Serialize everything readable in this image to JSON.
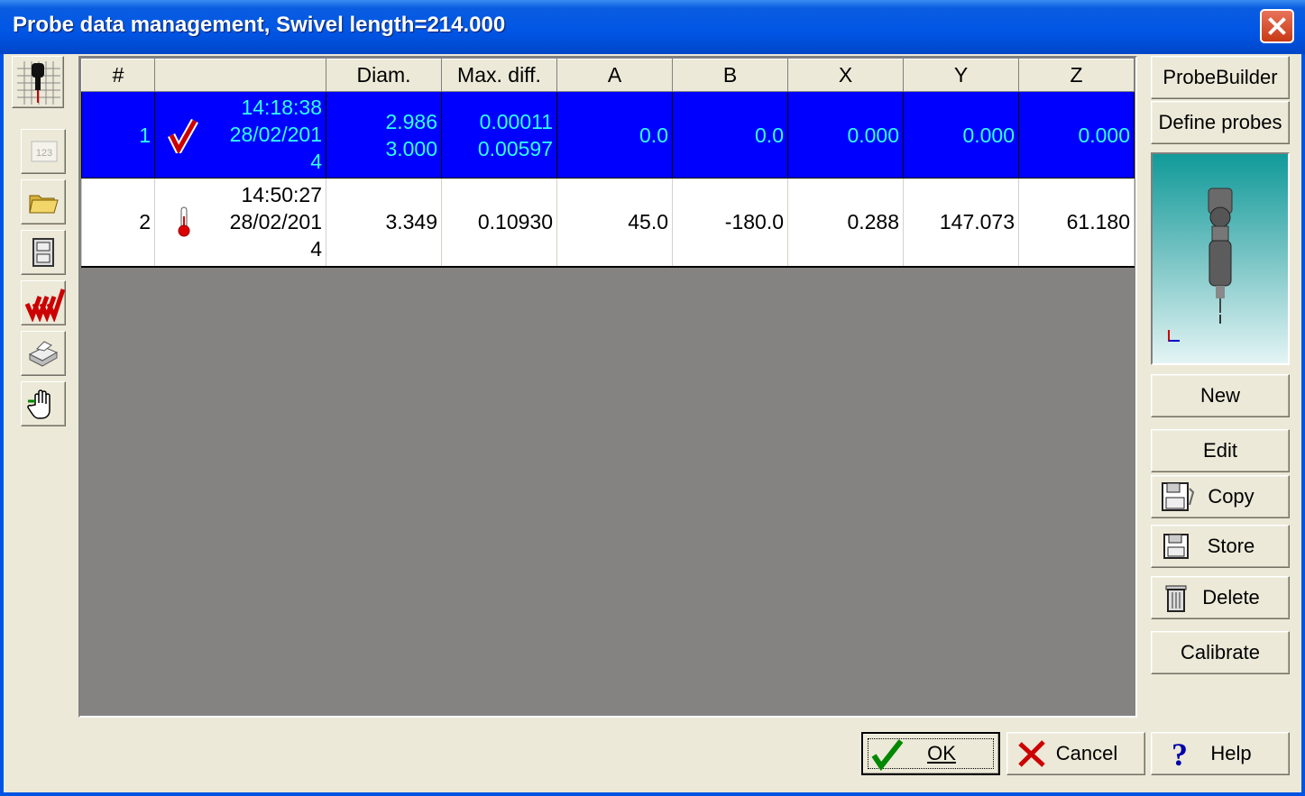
{
  "window": {
    "title": "Probe data management, Swivel length=214.000"
  },
  "table": {
    "columns": [
      "#",
      "",
      "Diam.",
      "Max. diff.",
      "A",
      "B",
      "X",
      "Y",
      "Z"
    ],
    "rows": [
      {
        "num": "1",
        "status_icon": "checkmark-icon",
        "time": "14:18:38",
        "date": "28/02/2014",
        "diam_1": "2.986",
        "diam_2": "3.000",
        "maxdiff_1": "0.00011",
        "maxdiff_2": "0.00597",
        "a": "0.0",
        "b": "0.0",
        "x": "0.000",
        "y": "0.000",
        "z": "0.000",
        "selected": true
      },
      {
        "num": "2",
        "status_icon": "thermometer-icon",
        "time": "14:50:27",
        "date": "28/02/2014",
        "diam_1": "3.349",
        "diam_2": "",
        "maxdiff_1": "0.10930",
        "maxdiff_2": "",
        "a": "45.0",
        "b": "-180.0",
        "x": "0.288",
        "y": "147.073",
        "z": "61.180",
        "selected": false
      }
    ]
  },
  "toolbar": {
    "items": [
      "probe-icon",
      "numbers-123-icon",
      "folder-open-icon",
      "file-cabinet-icon",
      "multi-check-icon",
      "printer-icon",
      "hand-icon"
    ]
  },
  "buttons": {
    "probebuilder": "ProbeBuilder",
    "define_probes": "Define probes",
    "new": "New",
    "edit": "Edit",
    "copy": "Copy",
    "store": "Store",
    "delete": "Delete",
    "calibrate": "Calibrate",
    "ok": "OK",
    "cancel": "Cancel",
    "help": "Help"
  }
}
